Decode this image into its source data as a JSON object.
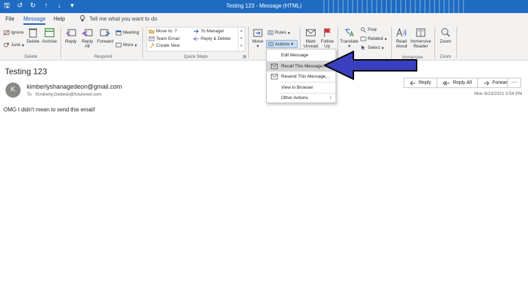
{
  "window": {
    "title": "Testing 123 - Message (HTML)"
  },
  "quick_access": {
    "save": "🖫",
    "undo": "↺",
    "redo": "↻",
    "up": "↑",
    "down": "↓",
    "more": "▾"
  },
  "tabs": {
    "file": "File",
    "message": "Message",
    "help": "Help"
  },
  "tell_me": {
    "text": "Tell me what you want to do"
  },
  "ribbon": {
    "delete_group": {
      "label": "Delete",
      "ignore": "Ignore",
      "junk": "Junk",
      "delete": "Delete",
      "archive": "Archive"
    },
    "respond_group": {
      "label": "Respond",
      "reply": "Reply",
      "reply_all_1": "Reply",
      "reply_all_2": "All",
      "forward": "Forward",
      "meeting": "Meeting",
      "more": "More"
    },
    "quick_steps_group": {
      "label": "Quick Steps",
      "move_to": "Move to: ?",
      "team_email": "Team Email",
      "create_new": "Create New",
      "to_manager": "To Manager",
      "reply_delete": "Reply & Delete"
    },
    "move_group": {
      "move": "Move",
      "rules": "Rules",
      "actions": "Actions"
    },
    "tags_group": {
      "mark_unread_1": "Mark",
      "mark_unread_2": "Unread",
      "follow_up_1": "Follow",
      "follow_up_2": "Up"
    },
    "editing_group": {
      "translate": "Translate",
      "find": "Find",
      "related": "Related",
      "select": "Select"
    },
    "immersive_group": {
      "label": "Immersive",
      "read_aloud_1": "Read",
      "read_aloud_2": "Aloud",
      "immersive_reader_1": "Immersive",
      "immersive_reader_2": "Reader"
    },
    "zoom_group": {
      "label": "Zoom",
      "zoom": "Zoom"
    }
  },
  "message": {
    "subject": "Testing 123",
    "avatar_initial": "K",
    "sender": "kimberlyshanagedeon@gmail.com",
    "to_label": "To",
    "to_address": "Kimberly.Gedeon@futurenet.com",
    "date": "Mon 8/23/2021 3:54 PM",
    "body": "OMG I didn't mean to send this email!"
  },
  "reply_buttons": {
    "reply": "Reply",
    "reply_all": "Reply All",
    "forward": "Forward",
    "more": "···"
  },
  "actions_menu": {
    "items": [
      {
        "label": "Edit Message"
      },
      {
        "label": "Recall This Message..."
      },
      {
        "label": "Resend This Message..."
      },
      {
        "label": "View in Browser"
      },
      {
        "label": "Other Actions"
      }
    ]
  },
  "colors": {
    "title_bar": "#1f6bc2",
    "accent": "#185abd",
    "arrow_fill": "#3a3fbf",
    "highlight": "#d6d5d4"
  },
  "icons": {
    "ignore": "ignore-icon",
    "junk": "junk-icon",
    "delete": "delete-icon",
    "archive": "archive-icon",
    "reply": "reply-icon",
    "reply_all": "reply-all-icon",
    "forward": "forward-icon",
    "meeting": "meeting-icon",
    "move": "move-icon",
    "rules": "rules-icon",
    "actions": "actions-icon",
    "mark_unread": "envelope-icon",
    "follow_up": "flag-icon",
    "translate": "translate-icon",
    "find": "find-icon",
    "read_aloud": "read-aloud-icon",
    "immersive_reader": "immersive-reader-icon",
    "zoom": "zoom-icon",
    "arrow": "arrow-annotation-icon"
  }
}
